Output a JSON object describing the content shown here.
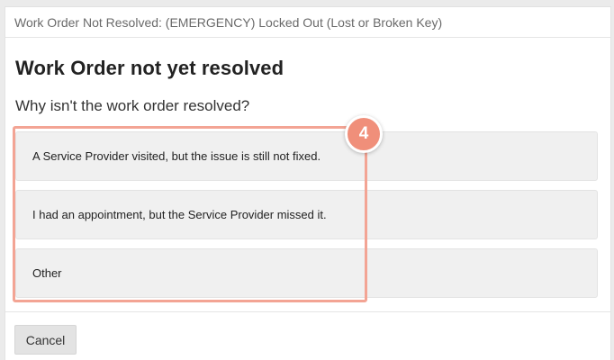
{
  "modal": {
    "header_title": "Work Order Not Resolved: (EMERGENCY) Locked Out (Lost or Broken Key)",
    "page_title": "Work Order not yet resolved",
    "question": "Why isn't the work order resolved?",
    "options": [
      {
        "label": "A Service Provider visited, but the issue is still not fixed."
      },
      {
        "label": "I had an appointment, but the Service Provider missed it."
      },
      {
        "label": "Other"
      }
    ],
    "cancel_label": "Cancel"
  },
  "annotation": {
    "step_number": "4",
    "highlight_color": "#f3a494",
    "badge_color": "#f08f7a"
  }
}
